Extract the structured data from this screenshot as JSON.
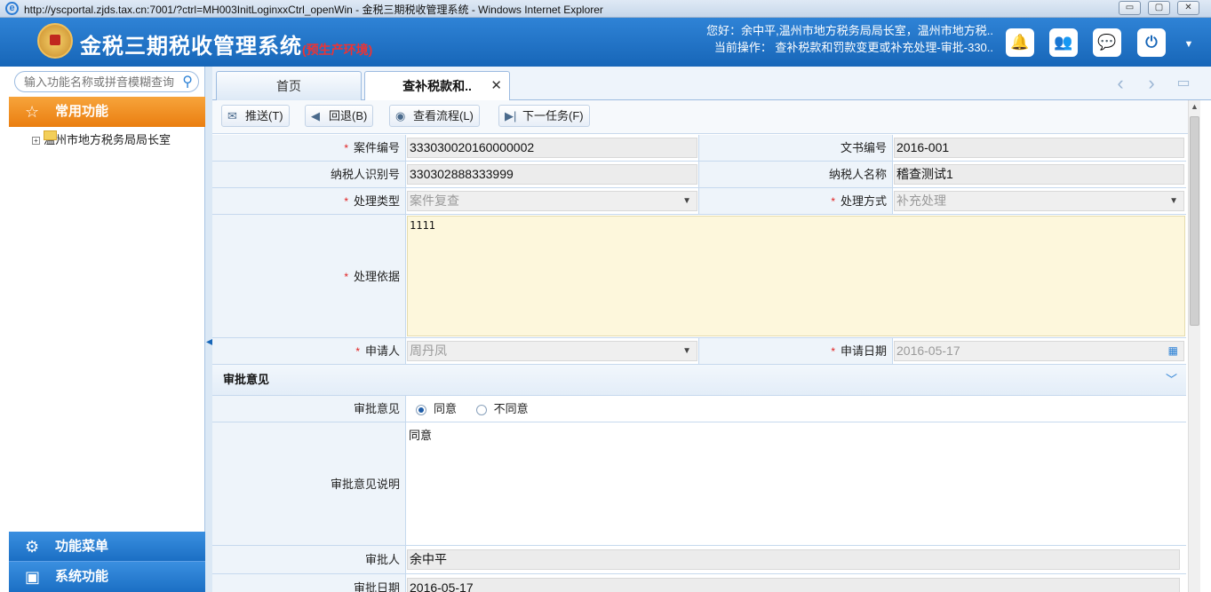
{
  "window": {
    "title": "http://yscportal.zjds.tax.cn:7001/?ctrl=MH003InitLoginxxCtrl_openWin - 金税三期税收管理系统 - Windows Internet Explorer",
    "minimize": "▭",
    "maximize": "▢",
    "close": "✕"
  },
  "header": {
    "system_name": "金税三期税收管理系统",
    "environment": "(预生产环境)",
    "greeting": "您好：余中平,温州市地方税务局局长室，温州市地方税..",
    "current_operation": "当前操作： 查补税款和罚款变更或补充处理-审批-330..",
    "icons": [
      "bell-icon",
      "users-icon",
      "chat-icon",
      "power-icon",
      "chevron-down-icon"
    ],
    "accent_color": "#1766b8"
  },
  "sidebar": {
    "search_placeholder": "输入功能名称或拼音模糊查询",
    "common_label": "常用功能",
    "tree_item": "温州市地方税务局局长室",
    "menu_label": "功能菜单",
    "system_label": "系统功能"
  },
  "tabs": {
    "home": "首页",
    "current": "查补税款和..",
    "close": "✕"
  },
  "toolbar": {
    "push": "推送(T)",
    "back": "回退(B)",
    "flow": "查看流程(L)",
    "next": "下一任务(F)"
  },
  "form": {
    "case_no_label": "案件编号",
    "case_no": "333030020160000002",
    "doc_no_label": "文书编号",
    "doc_no": "2016-001",
    "taxpayer_id_label": "纳税人识别号",
    "taxpayer_id": "330302888333999",
    "taxpayer_name_label": "纳税人名称",
    "taxpayer_name": "稽查测试1",
    "process_type_label": "处理类型",
    "process_type": "案件复查",
    "process_method_label": "处理方式",
    "process_method": "补充处理",
    "basis_label": "处理依据",
    "basis": "1111",
    "applicant_label": "申请人",
    "applicant": "周丹凤",
    "apply_date_label": "申请日期",
    "apply_date": "2016-05-17",
    "required_mark": "*"
  },
  "approval": {
    "section_title": "审批意见",
    "opinion_label": "审批意见",
    "agree": "同意",
    "disagree": "不同意",
    "selected": "同意",
    "remark_label": "审批意见说明",
    "remark": "同意",
    "approver_label": "审批人",
    "approver": "余中平",
    "date_label": "审批日期",
    "date": "2016-05-17"
  }
}
